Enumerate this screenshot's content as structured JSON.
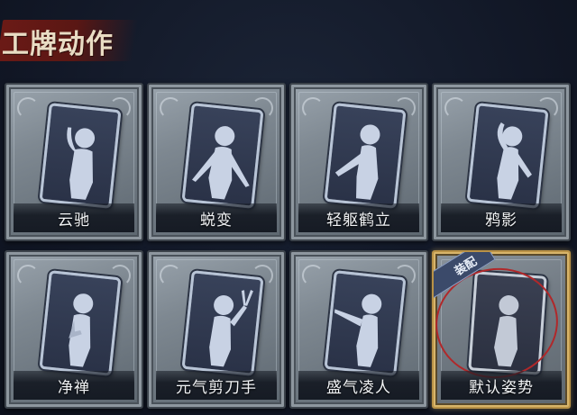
{
  "header": {
    "title": "工牌动作"
  },
  "cards": [
    {
      "label": "云驰",
      "pose": "hand-raised-left",
      "equipped": false
    },
    {
      "label": "蜕变",
      "pose": "arms-out",
      "equipped": false
    },
    {
      "label": "轻躯鹤立",
      "pose": "arm-out-left",
      "equipped": false
    },
    {
      "label": "鸦影",
      "pose": "hand-on-head",
      "equipped": false
    },
    {
      "label": "净禅",
      "pose": "hand-chest",
      "equipped": false
    },
    {
      "label": "元气剪刀手",
      "pose": "peace-sign",
      "equipped": false
    },
    {
      "label": "盛气凌人",
      "pose": "point-left",
      "equipped": false
    },
    {
      "label": "默认姿势",
      "pose": "standing",
      "equipped": true,
      "badge": "装配"
    }
  ],
  "colors": {
    "background": "#121827",
    "title_banner": "#6b1a16",
    "equipped_border": "#d8b56a",
    "highlight_circle": "#b0282a",
    "badge": "#3b4a6a"
  }
}
